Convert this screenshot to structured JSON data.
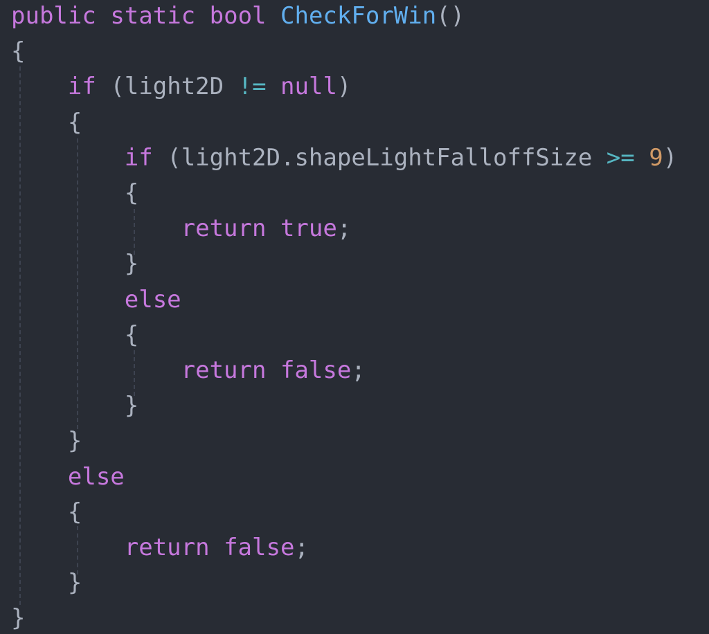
{
  "code": {
    "language": "C#",
    "colors": {
      "background": "#282c34",
      "keyword": "#c678dd",
      "function": "#61afef",
      "operator": "#56b6c2",
      "number": "#d19a66",
      "text": "#abb2bf"
    },
    "lines": [
      {
        "tokens": [
          {
            "t": "public",
            "k": "kw"
          },
          {
            "t": " "
          },
          {
            "t": "static",
            "k": "kw"
          },
          {
            "t": " "
          },
          {
            "t": "bool",
            "k": "kw"
          },
          {
            "t": " "
          },
          {
            "t": "CheckForWin",
            "k": "fn"
          },
          {
            "t": "()",
            "k": "punc"
          }
        ]
      },
      {
        "tokens": [
          {
            "t": "{",
            "k": "punc"
          }
        ]
      },
      {
        "tokens": [
          {
            "t": "    "
          },
          {
            "t": "if",
            "k": "kw"
          },
          {
            "t": " "
          },
          {
            "t": "(",
            "k": "punc"
          },
          {
            "t": "light2D",
            "k": "id"
          },
          {
            "t": " "
          },
          {
            "t": "!=",
            "k": "op"
          },
          {
            "t": " "
          },
          {
            "t": "null",
            "k": "kw"
          },
          {
            "t": ")",
            "k": "punc"
          }
        ]
      },
      {
        "tokens": [
          {
            "t": "    "
          },
          {
            "t": "{",
            "k": "punc"
          }
        ]
      },
      {
        "tokens": [
          {
            "t": "        "
          },
          {
            "t": "if",
            "k": "kw"
          },
          {
            "t": " "
          },
          {
            "t": "(",
            "k": "punc"
          },
          {
            "t": "light2D.shapeLightFalloffSize",
            "k": "id"
          },
          {
            "t": " "
          },
          {
            "t": ">=",
            "k": "op"
          },
          {
            "t": " "
          },
          {
            "t": "9",
            "k": "num"
          },
          {
            "t": ")",
            "k": "punc"
          }
        ]
      },
      {
        "tokens": [
          {
            "t": "        "
          },
          {
            "t": "{",
            "k": "punc"
          }
        ]
      },
      {
        "tokens": [
          {
            "t": "            "
          },
          {
            "t": "return",
            "k": "kw"
          },
          {
            "t": " "
          },
          {
            "t": "true",
            "k": "kw"
          },
          {
            "t": ";",
            "k": "punc"
          }
        ]
      },
      {
        "tokens": [
          {
            "t": "        "
          },
          {
            "t": "}",
            "k": "punc"
          }
        ]
      },
      {
        "tokens": [
          {
            "t": "        "
          },
          {
            "t": "else",
            "k": "kw"
          }
        ]
      },
      {
        "tokens": [
          {
            "t": "        "
          },
          {
            "t": "{",
            "k": "punc"
          }
        ]
      },
      {
        "tokens": [
          {
            "t": "            "
          },
          {
            "t": "return",
            "k": "kw"
          },
          {
            "t": " "
          },
          {
            "t": "false",
            "k": "kw"
          },
          {
            "t": ";",
            "k": "punc"
          }
        ]
      },
      {
        "tokens": [
          {
            "t": "        "
          },
          {
            "t": "}",
            "k": "punc"
          }
        ]
      },
      {
        "tokens": [
          {
            "t": "    "
          },
          {
            "t": "}",
            "k": "punc"
          }
        ]
      },
      {
        "tokens": [
          {
            "t": "    "
          },
          {
            "t": "else",
            "k": "kw"
          }
        ]
      },
      {
        "tokens": [
          {
            "t": "    "
          },
          {
            "t": "{",
            "k": "punc"
          }
        ]
      },
      {
        "tokens": [
          {
            "t": "        "
          },
          {
            "t": "return",
            "k": "kw"
          },
          {
            "t": " "
          },
          {
            "t": "false",
            "k": "kw"
          },
          {
            "t": ";",
            "k": "punc"
          }
        ]
      },
      {
        "tokens": [
          {
            "t": "    "
          },
          {
            "t": "}",
            "k": "punc"
          }
        ]
      },
      {
        "tokens": [
          {
            "t": "}",
            "k": "punc"
          }
        ]
      }
    ]
  }
}
